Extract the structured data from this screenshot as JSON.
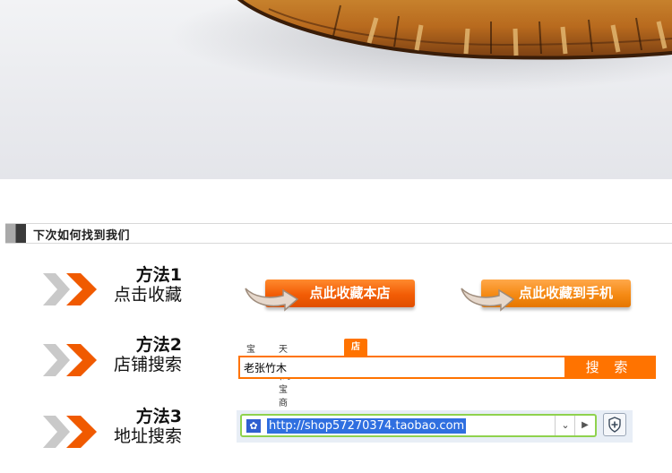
{
  "section": {
    "title": "下次如何找到我们"
  },
  "methods": [
    {
      "title": "方法1",
      "desc": "点击收藏"
    },
    {
      "title": "方法2",
      "desc": "店铺搜索"
    },
    {
      "title": "方法3",
      "desc": "地址搜索"
    }
  ],
  "favorite": {
    "shop_button": "点此收藏本店",
    "phone_button": "点此收藏到手机"
  },
  "search": {
    "tabs": [
      "宝贝",
      "天猫(淘宝商城)",
      "店铺"
    ],
    "active_tab": "店铺",
    "query": "老张竹木",
    "button": "搜 索"
  },
  "address": {
    "url": "http://shop57270374.taobao.com"
  },
  "colors": {
    "accent": "#ff7300",
    "chevron_gray": "#c9c9c9",
    "chevron_orange": "#f05a00"
  }
}
